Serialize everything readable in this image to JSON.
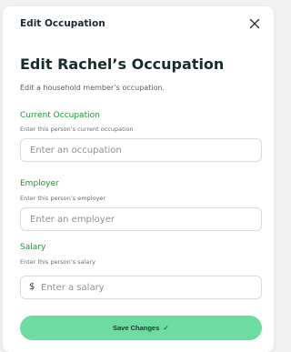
{
  "topbar": {
    "title": "Edit Occupation"
  },
  "header": {
    "title": "Edit Rachel’s Occupation",
    "subtitle": "Edit a household member’s occupation."
  },
  "fields": {
    "occupation": {
      "label": "Current Occupation",
      "help": "Enter this person’s current occupation",
      "placeholder": "Enter an occupation"
    },
    "employer": {
      "label": "Employer",
      "help": "Enter this person’s employer",
      "placeholder": "Enter an employer"
    },
    "salary": {
      "label": "Salary",
      "help": "Enter this person’s salary",
      "prefix": "$",
      "placeholder": "Enter a salary"
    }
  },
  "actions": {
    "save_label": "Save Changes",
    "save_icon": "✓"
  },
  "icons": {
    "close": "close-icon",
    "check": "check-icon"
  },
  "colors": {
    "accent_green": "#23963a",
    "button_bg": "#6ddca0",
    "heading": "#182c2c"
  }
}
